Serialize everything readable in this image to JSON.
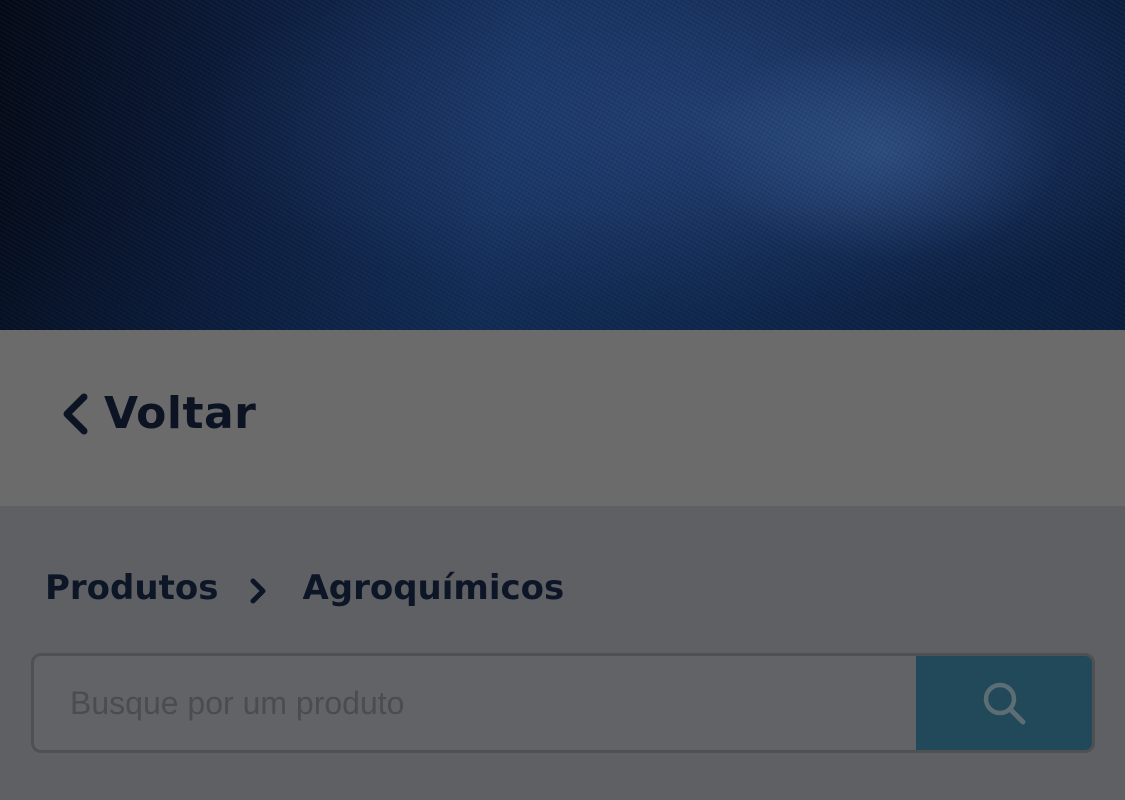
{
  "navigation": {
    "back_label": "Voltar"
  },
  "breadcrumb": {
    "items": [
      "Produtos",
      "Agroquímicos"
    ]
  },
  "search": {
    "placeholder": "Busque por um produto",
    "value": ""
  },
  "icons": {
    "back": "chevron-left-icon",
    "separator": "chevron-right-icon",
    "search": "search-icon"
  },
  "colors": {
    "hero_blue": "#14305c",
    "search_button": "#21495a",
    "text_dark": "#0d1626"
  }
}
